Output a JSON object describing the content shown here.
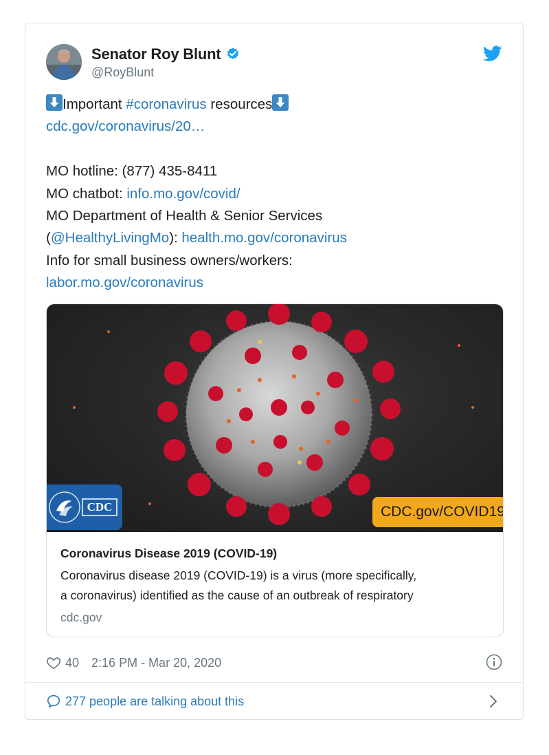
{
  "author": {
    "name": "Senator Roy Blunt",
    "handle": "@RoyBlunt"
  },
  "icons": {
    "verified": "verified-badge-icon",
    "brand": "twitter-bird-icon",
    "emoji": "down-arrow-emoji",
    "like": "heart-icon",
    "info": "info-icon",
    "reply": "speech-bubble-icon",
    "chevron": "chevron-right-icon"
  },
  "tweet": {
    "line1_pre": "Important ",
    "line1_hashtag": "#coronavirus",
    "line1_post": " resources",
    "line2_link": "cdc.gov/coronavirus/20…",
    "hotline": "MO hotline: (877) 435-8411",
    "chatbot_label": "MO chatbot: ",
    "chatbot_link": "info.mo.gov/covid/",
    "dept": "MO Department of Health & Senior Services",
    "paren_open": "(",
    "mention": "@HealthyLivingMo",
    "paren_close": "): ",
    "health_link": "health.mo.gov/coronavirus",
    "biz": "Info for small business owners/workers:",
    "labor_link": "labor.mo.gov/coronavirus"
  },
  "card": {
    "logo_text": "CDC",
    "image_url_text": "CDC.gov/COVID19",
    "title": "Coronavirus Disease 2019 (COVID-19)",
    "desc_line1": "Coronavirus disease 2019 (COVID-19) is a virus (more specifically,",
    "desc_line2": "a coronavirus) identified as the cause of an outbreak of respiratory",
    "domain": "cdc.gov"
  },
  "meta": {
    "likes": "40",
    "timestamp": "2:16 PM - Mar 20, 2020"
  },
  "footer": {
    "talking": "277 people are talking about this"
  },
  "colors": {
    "link": "#2b7bb9",
    "verified": "#1da1f2",
    "cdc_blue": "#1f5fa7",
    "cdc_orange": "#f2a81d",
    "virus_red": "#c8102e"
  }
}
